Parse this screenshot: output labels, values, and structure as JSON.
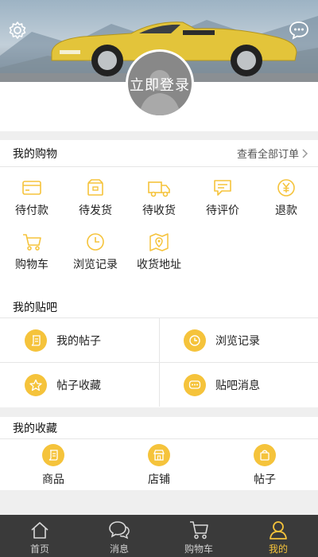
{
  "header": {
    "login_label": "立即登录",
    "icons": {
      "settings": "settings-gear-icon",
      "messages": "chat-bubble-icon"
    }
  },
  "orders": {
    "title": "我的购物",
    "all_orders_label": "查看全部订单",
    "items": [
      {
        "label": "待付款",
        "icon": "card-icon"
      },
      {
        "label": "待发货",
        "icon": "box-icon"
      },
      {
        "label": "待收货",
        "icon": "truck-icon"
      },
      {
        "label": "待评价",
        "icon": "comment-icon"
      },
      {
        "label": "退款",
        "icon": "yen-icon"
      },
      {
        "label": "购物车",
        "icon": "cart-icon"
      },
      {
        "label": "浏览记录",
        "icon": "clock-icon"
      },
      {
        "label": "收货地址",
        "icon": "map-pin-icon"
      }
    ]
  },
  "forum": {
    "title": "我的贴吧",
    "items": [
      {
        "label": "我的帖子",
        "icon": "scroll-icon"
      },
      {
        "label": "浏览记录",
        "icon": "clock-icon"
      },
      {
        "label": "帖子收藏",
        "icon": "star-icon"
      },
      {
        "label": "贴吧消息",
        "icon": "message-icon"
      }
    ]
  },
  "favorites": {
    "title": "我的收藏",
    "items": [
      {
        "label": "商品",
        "icon": "product-icon"
      },
      {
        "label": "店铺",
        "icon": "shop-icon"
      },
      {
        "label": "帖子",
        "icon": "bag-icon"
      }
    ]
  },
  "tabbar": {
    "active": "我的",
    "items": [
      {
        "label": "首页",
        "icon": "home-icon"
      },
      {
        "label": "消息",
        "icon": "chat-bubbles-icon"
      },
      {
        "label": "购物车",
        "icon": "cart-icon"
      },
      {
        "label": "我的",
        "icon": "user-icon"
      }
    ]
  },
  "colors": {
    "accent": "#f5c33b",
    "tabbar_bg": "#3a3a3a",
    "page_bg": "#efefef",
    "divider": "#e6e6e6"
  }
}
